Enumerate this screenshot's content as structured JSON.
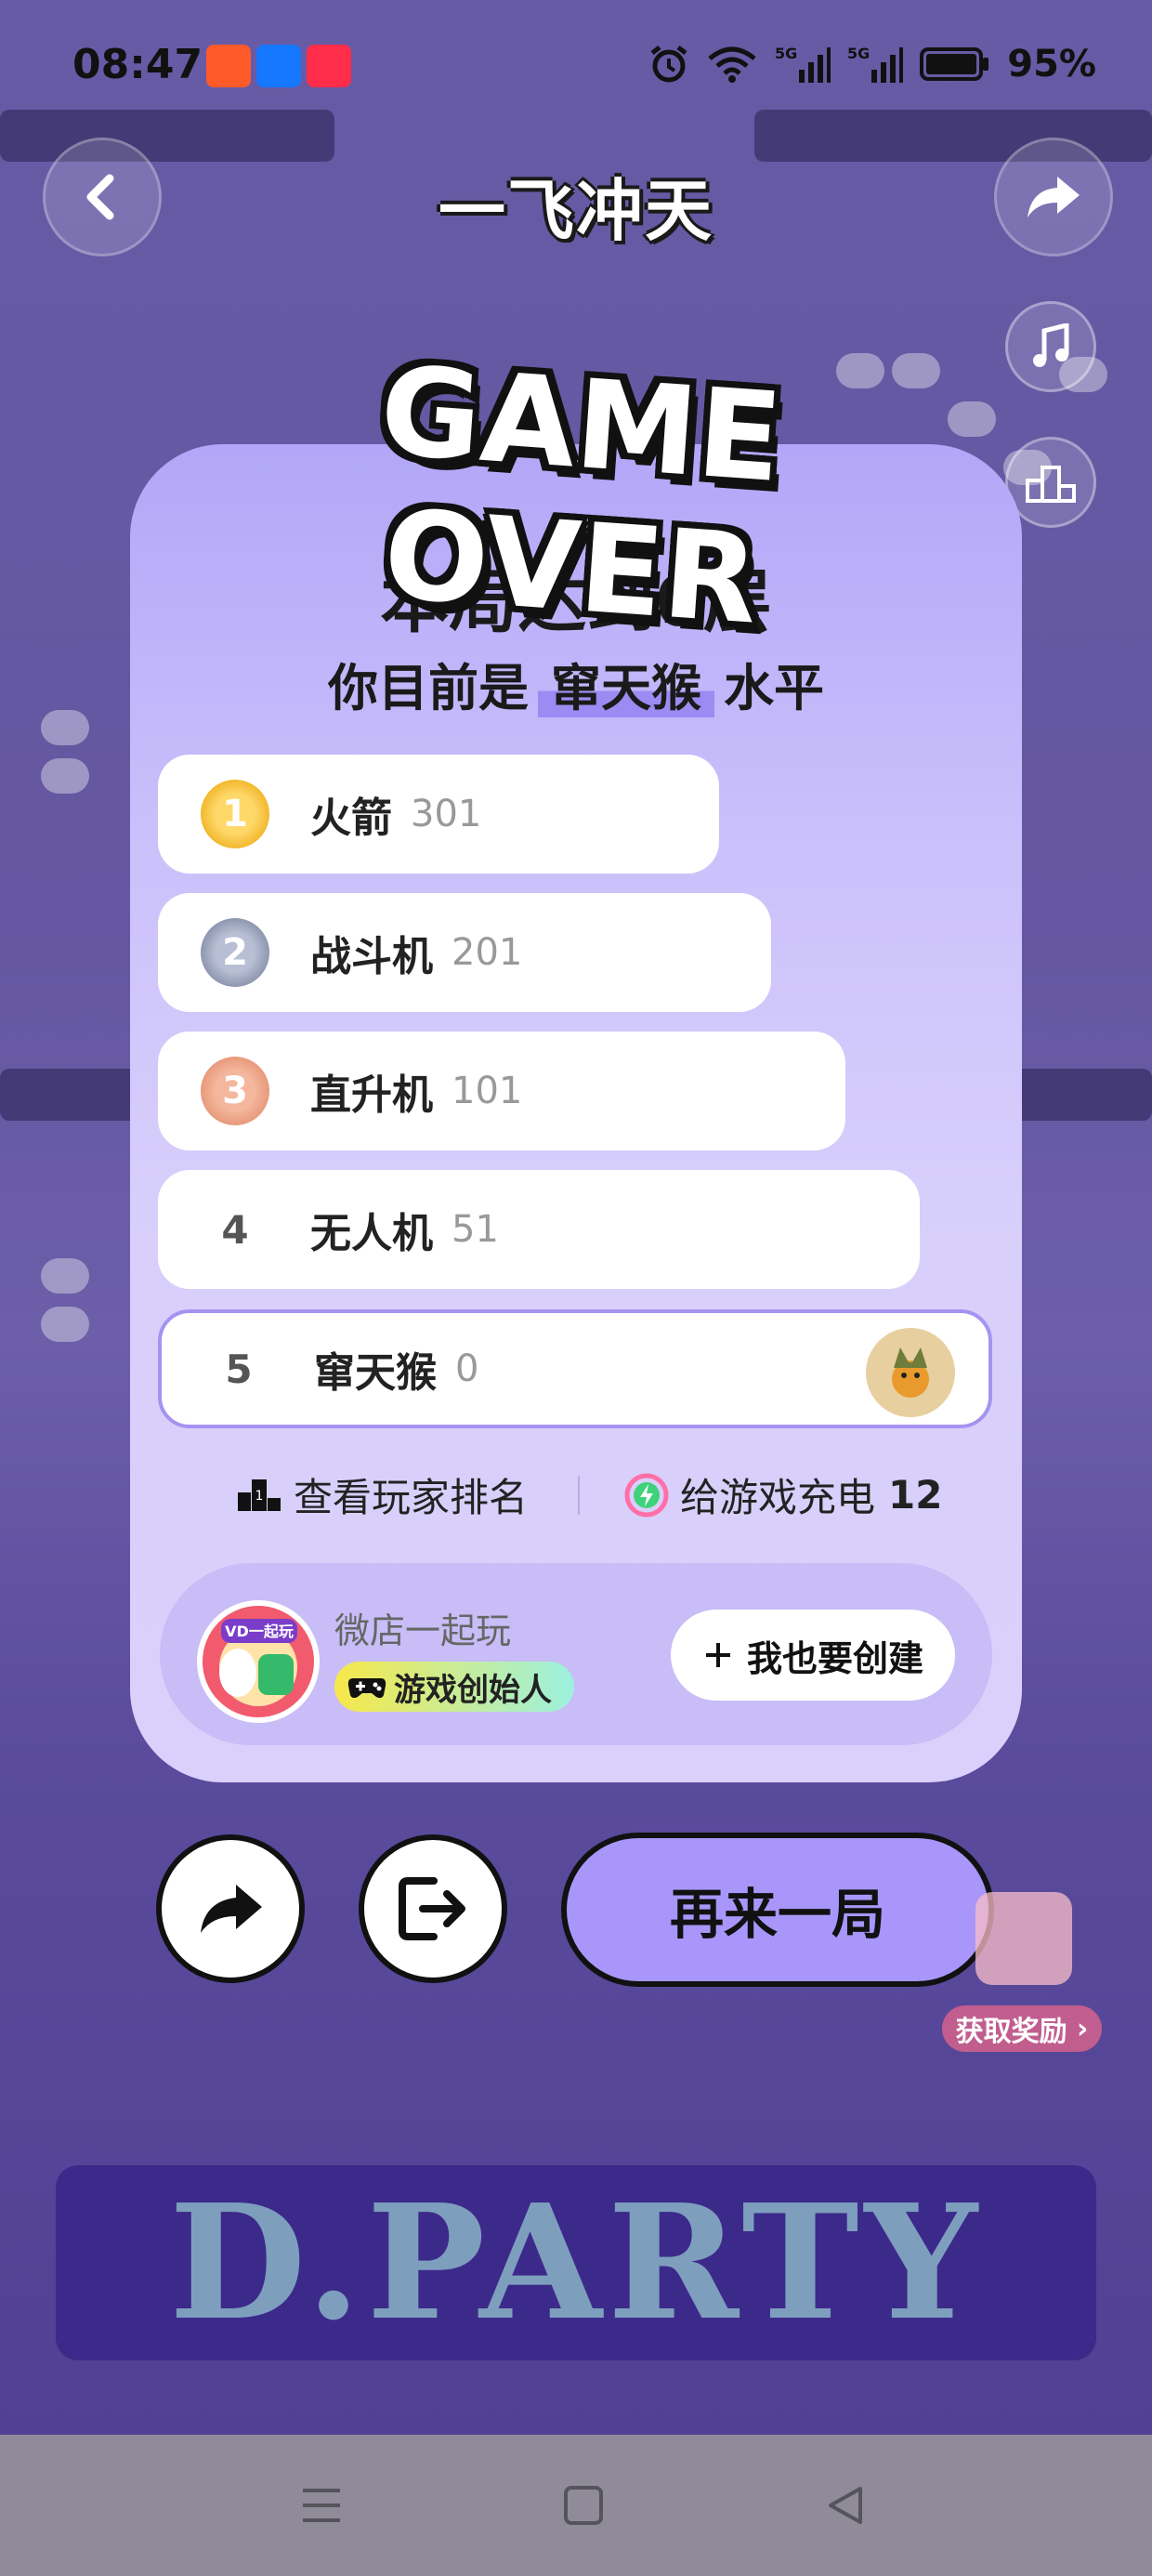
{
  "status_bar": {
    "time": "08:47",
    "battery": "95%"
  },
  "game": {
    "title": "一飞冲天",
    "game_over": "GAME OVER"
  },
  "result": {
    "headline": "本局达到0层",
    "level_prefix": "你目前是",
    "level_name": "窜天猴",
    "level_suffix": "水平"
  },
  "ranks": [
    {
      "position": "1",
      "name": "火箭",
      "score": "301"
    },
    {
      "position": "2",
      "name": "战斗机",
      "score": "201"
    },
    {
      "position": "3",
      "name": "直升机",
      "score": "101"
    },
    {
      "position": "4",
      "name": "无人机",
      "score": "51"
    },
    {
      "position": "5",
      "name": "窜天猴",
      "score": "0"
    }
  ],
  "links": {
    "leaderboard": "查看玩家排名",
    "charge": "给游戏充电",
    "charge_count": "12"
  },
  "creator": {
    "name": "微店一起玩",
    "badge": "游戏创始人",
    "avatar_tag": "VD一起玩",
    "create_label": "我也要创建"
  },
  "actions": {
    "play_again": "再来一局",
    "reward": "获取奖励"
  },
  "background": {
    "banner": "D.PARTY"
  }
}
